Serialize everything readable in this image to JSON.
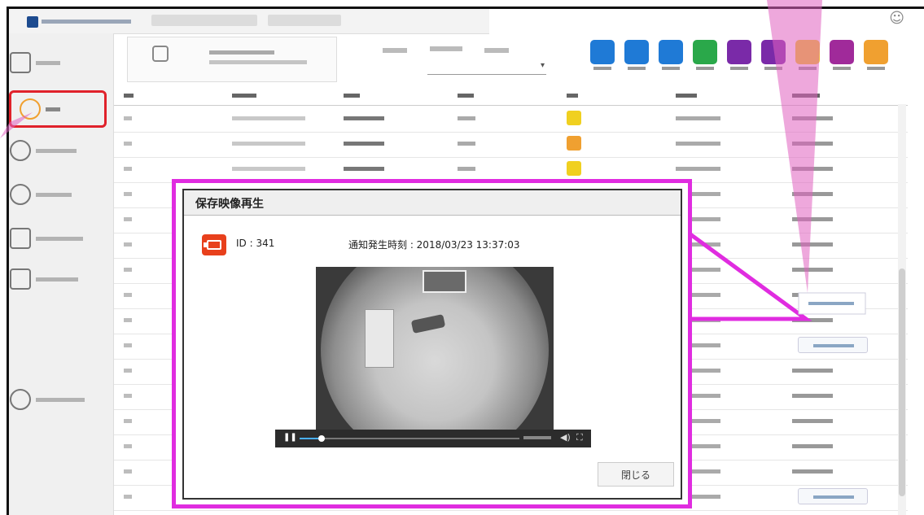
{
  "modal": {
    "title": "保存映像再生",
    "id_text": "ID : 341",
    "notified_at": "通知発生時刻 : 2018/03/23 13:37:03",
    "close_label": "閉じる",
    "video_progress": 0.1
  },
  "colors": {
    "callout_pink": "#e02ce0",
    "active_highlight": "#e0222b",
    "record_icon": "#e8401c"
  },
  "sidebar": {
    "items": [
      {
        "icon": "home-icon"
      },
      {
        "icon": "alert-icon",
        "active": true
      },
      {
        "icon": "user-icon"
      },
      {
        "icon": "user-add-icon"
      },
      {
        "icon": "group-icon"
      },
      {
        "icon": "document-icon"
      },
      {
        "icon": "settings-icon"
      }
    ]
  },
  "type_icons": [
    {
      "name": "all-icon",
      "color": "#1f7ad6"
    },
    {
      "name": "door-icon",
      "color": "#1f7ad6"
    },
    {
      "name": "fall-icon",
      "color": "#1f7ad6"
    },
    {
      "name": "bed-icon",
      "color": "#2aa84a"
    },
    {
      "name": "sensor-icon",
      "color": "#7a2aa8"
    },
    {
      "name": "monitor-icon",
      "color": "#7a2aa8"
    },
    {
      "name": "fall-alert-icon",
      "color": "#f0d020"
    },
    {
      "name": "wander-icon",
      "color": "#a02a9a"
    },
    {
      "name": "call-icon",
      "color": "#f0a030"
    }
  ],
  "row_type_colors": [
    "#f0d020",
    "#f0a030",
    "#f0d020"
  ]
}
